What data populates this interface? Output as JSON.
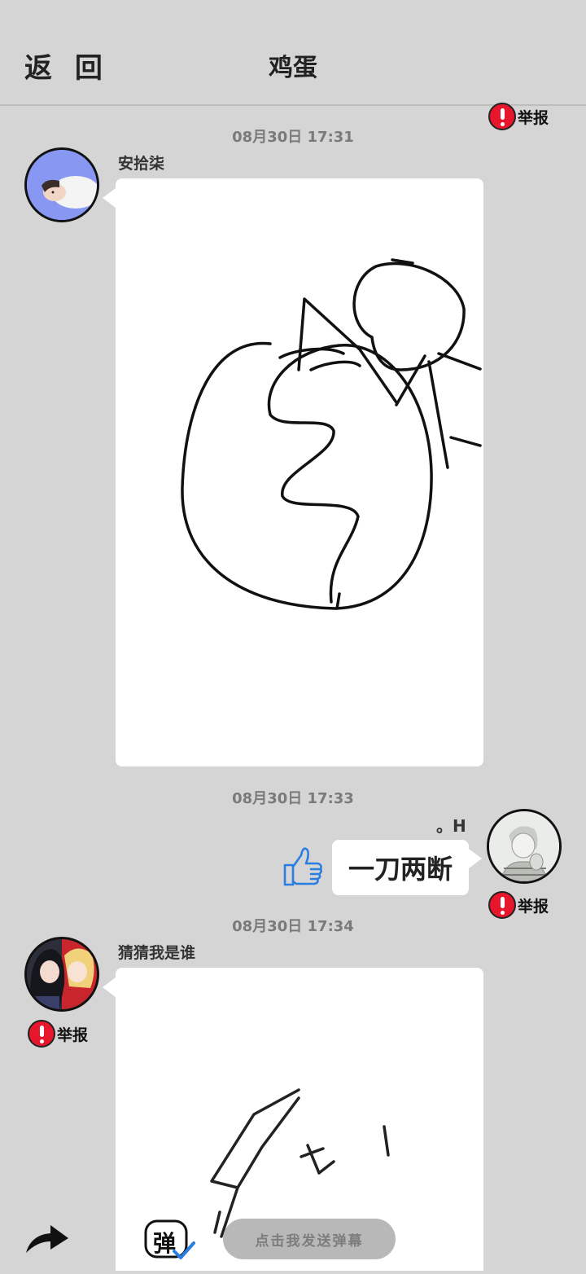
{
  "header": {
    "back_label": "返 回",
    "title": "鸡蛋"
  },
  "report_label": "举报",
  "messages": [
    {
      "timestamp": "08月30日  17:31",
      "sender": "安拾柒"
    },
    {
      "timestamp": "08月30日  17:33",
      "prefix_text": "。H",
      "text": "一刀两断"
    },
    {
      "timestamp": "08月30日  17:34",
      "sender": "猜猜我是谁"
    }
  ],
  "bottom": {
    "danmaku_placeholder": "点击我发送弹幕",
    "danmaku_icon_text": "弹"
  },
  "colors": {
    "background": "#d5d5d5",
    "report_red": "#e8162c",
    "like_blue": "#2a7de1"
  },
  "icons": {
    "like": "thumbs-up-icon",
    "report": "exclamation-icon",
    "share": "share-arrow-icon",
    "danmaku": "danmaku-icon"
  }
}
